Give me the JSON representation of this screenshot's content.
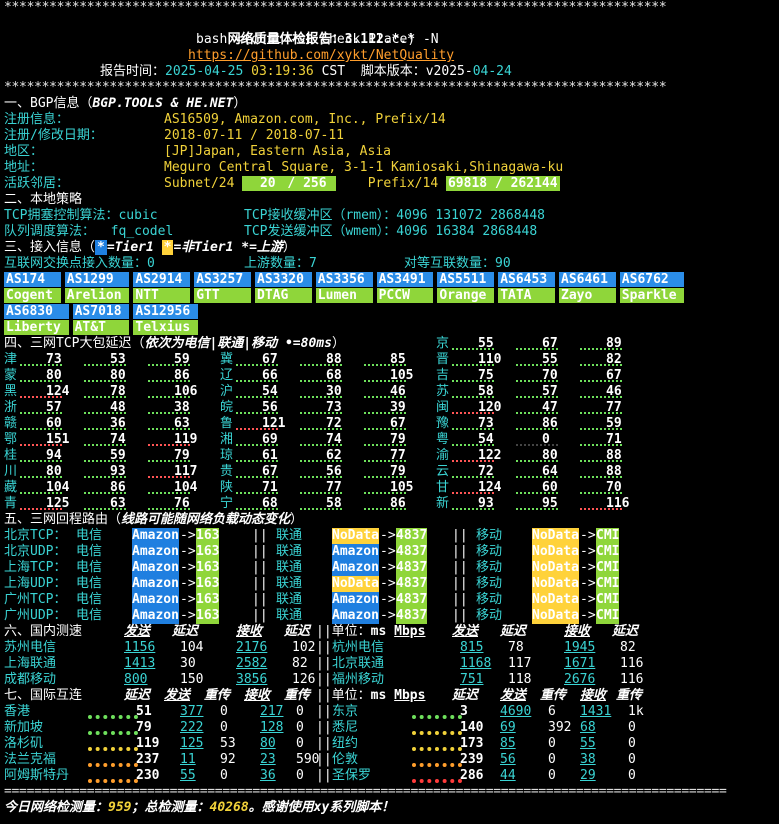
{
  "header": {
    "stars_line": "****************************************************************************************",
    "title": "网络质量体检报告：3.112.*.*",
    "command": "bash <(curl -sL Check.Place) -N",
    "url": "https://github.com/xykt/NetQuality",
    "report_time_label": "报告时间：",
    "report_date": "2025-04-25",
    "report_clock": "03:19:36",
    "report_tz": "CST",
    "script_version_label": "脚本版本：",
    "script_version_prefix": "v2025-",
    "script_version_date": "04-24"
  },
  "bgp": {
    "section_title": "一、BGP信息（",
    "section_source": "BGP.TOOLS & HE.NET",
    "section_close": "）",
    "reg_info_label": "注册信息：",
    "reg_info_value": "AS16509, Amazon.com, Inc., Prefix/14",
    "reg_date_label": "注册/修改日期：",
    "reg_date_value": "2018-07-11 / 2018-07-11",
    "region_label": "地区：",
    "region_value": "[JP]Japan, Eastern Asia, Asia",
    "address_label": "地址：",
    "address_value": "Meguro Central Square, 3-1-1 Kamiosaki,Shinagawa-ku",
    "neighbors_label": "活跃邻居：",
    "subnet_label": "Subnet/24",
    "subnet_a": "20",
    "subnet_b": "256",
    "prefix_label": "Prefix/14",
    "prefix_a": "69818",
    "prefix_b": "262144"
  },
  "local": {
    "section_title": "二、本地策略",
    "congestion_label": "TCP拥塞控制算法：",
    "congestion_value": "cubic",
    "rmem_label": "TCP接收缓冲区（rmem）：",
    "rmem_value": "4096 131072 2868448",
    "qdisc_label": "队列调度算法：",
    "qdisc_value": "fq_codel",
    "wmem_label": "TCP发送缓冲区（wmem）：",
    "wmem_value": "4096 16384 2868448"
  },
  "access": {
    "section_title": "三、接入信息（",
    "legend_tier1": "=Tier1",
    "legend_nontier1": "=非Tier1",
    "legend_upstream": "=上游",
    "legend_close": "）",
    "ix_label": "互联网交换点接入数量：",
    "ix_value": "0",
    "upstream_label": "上游数量：",
    "upstream_value": "7",
    "peer_label": "对等互联数量：",
    "peer_value": "90",
    "row1": [
      {
        "as": "AS174",
        "name": "Cogent"
      },
      {
        "as": "AS1299",
        "name": "Arelion"
      },
      {
        "as": "AS2914",
        "name": "NTT"
      },
      {
        "as": "AS3257",
        "name": "GTT"
      },
      {
        "as": "AS3320",
        "name": "DTAG"
      },
      {
        "as": "AS3356",
        "name": "Lumen"
      },
      {
        "as": "AS3491",
        "name": "PCCW"
      },
      {
        "as": "AS5511",
        "name": "Orange"
      },
      {
        "as": "AS6453",
        "name": "TATA"
      },
      {
        "as": "AS6461",
        "name": "Zayo"
      },
      {
        "as": "AS6762",
        "name": "Sparkle"
      }
    ],
    "row2": [
      {
        "as": "AS6830",
        "name": "Liberty"
      },
      {
        "as": "AS7018",
        "name": "AT&T"
      },
      {
        "as": "AS12956",
        "name": "Telxius"
      }
    ]
  },
  "latency": {
    "section_title": "四、三网TCP大包延迟（",
    "section_note": "依次为电信|联通|移动 •=80ms",
    "section_close": "）",
    "rows": [
      [
        [
          "京",
          "55",
          "67",
          "89"
        ]
      ],
      [
        [
          "津",
          "73",
          "53",
          "59"
        ],
        [
          "冀",
          "67",
          "88",
          "85"
        ],
        [
          "晋",
          "110",
          "55",
          "82"
        ]
      ],
      [
        [
          "蒙",
          "80",
          "80",
          "86"
        ],
        [
          "辽",
          "66",
          "68",
          "105"
        ],
        [
          "吉",
          "75",
          "70",
          "67"
        ]
      ],
      [
        [
          "黑",
          "124",
          "78",
          "106"
        ],
        [
          "沪",
          "54",
          "30",
          "46"
        ],
        [
          "苏",
          "58",
          "57",
          "46"
        ]
      ],
      [
        [
          "浙",
          "57",
          "48",
          "38"
        ],
        [
          "皖",
          "56",
          "73",
          "39"
        ],
        [
          "闽",
          "120",
          "47",
          "77"
        ]
      ],
      [
        [
          "赣",
          "60",
          "36",
          "63"
        ],
        [
          "鲁",
          "121",
          "72",
          "67"
        ],
        [
          "豫",
          "73",
          "86",
          "59"
        ]
      ],
      [
        [
          "鄂",
          "151",
          "74",
          "119"
        ],
        [
          "湘",
          "69",
          "74",
          "79"
        ],
        [
          "粤",
          "54",
          "0",
          "71"
        ]
      ],
      [
        [
          "桂",
          "94",
          "59",
          "79"
        ],
        [
          "琼",
          "61",
          "62",
          "77"
        ],
        [
          "渝",
          "122",
          "80",
          "88"
        ]
      ],
      [
        [
          "川",
          "80",
          "93",
          "117"
        ],
        [
          "贵",
          "67",
          "56",
          "79"
        ],
        [
          "云",
          "72",
          "64",
          "88"
        ]
      ],
      [
        [
          "藏",
          "104",
          "86",
          "104"
        ],
        [
          "陕",
          "71",
          "77",
          "105"
        ],
        [
          "甘",
          "124",
          "60",
          "70"
        ]
      ],
      [
        [
          "青",
          "125",
          "63",
          "76"
        ],
        [
          "宁",
          "68",
          "58",
          "86"
        ],
        [
          "新",
          "93",
          "95",
          "116"
        ]
      ]
    ]
  },
  "routes": {
    "section_title": "五、三网回程路由（",
    "section_note": "线路可能随网络负载动态变化",
    "section_close": "）",
    "rows": [
      {
        "label": "北京TCP：",
        "isp1": "电信",
        "r1a": "Amazon",
        "r1b": "163",
        "isp2": "联通",
        "r2a": "NoData",
        "r2b": "4837",
        "isp3": "移动",
        "r3a": "NoData",
        "r3b": "CMI"
      },
      {
        "label": "北京UDP：",
        "isp1": "电信",
        "r1a": "Amazon",
        "r1b": "163",
        "isp2": "联通",
        "r2a": "Amazon",
        "r2b": "4837",
        "isp3": "移动",
        "r3a": "NoData",
        "r3b": "CMI"
      },
      {
        "label": "上海TCP：",
        "isp1": "电信",
        "r1a": "Amazon",
        "r1b": "163",
        "isp2": "联通",
        "r2a": "Amazon",
        "r2b": "4837",
        "isp3": "移动",
        "r3a": "NoData",
        "r3b": "CMI"
      },
      {
        "label": "上海UDP：",
        "isp1": "电信",
        "r1a": "Amazon",
        "r1b": "163",
        "isp2": "联通",
        "r2a": "NoData",
        "r2b": "4837",
        "isp3": "移动",
        "r3a": "NoData",
        "r3b": "CMI"
      },
      {
        "label": "广州TCP：",
        "isp1": "电信",
        "r1a": "Amazon",
        "r1b": "163",
        "isp2": "联通",
        "r2a": "Amazon",
        "r2b": "4837",
        "isp3": "移动",
        "r3a": "NoData",
        "r3b": "CMI"
      },
      {
        "label": "广州UDP：",
        "isp1": "电信",
        "r1a": "Amazon",
        "r1b": "163",
        "isp2": "联通",
        "r2a": "Amazon",
        "r2b": "4837",
        "isp3": "移动",
        "r3a": "NoData",
        "r3b": "CMI"
      }
    ]
  },
  "domestic": {
    "section_title": "六、国内测速",
    "col_send": "发送",
    "col_lat": "延迟",
    "col_recv": "接收",
    "col_lat2": "延迟",
    "unit_label": "单位：",
    "unit_ms": "ms",
    "unit_mbps": "Mbps",
    "rows": [
      {
        "l": "苏州电信",
        "ls": "1156",
        "ll": "104",
        "lr": "2176",
        "ll2": "102",
        "r": "杭州电信",
        "rs": "815",
        "rl": "78",
        "rr": "1945",
        "rl2": "82"
      },
      {
        "l": "上海联通",
        "ls": "1413",
        "ll": "30",
        "lr": "2582",
        "ll2": "82",
        "r": "北京联通",
        "rs": "1168",
        "rl": "117",
        "rr": "1671",
        "rl2": "116"
      },
      {
        "l": "成都移动",
        "ls": "800",
        "ll": "150",
        "lr": "3856",
        "ll2": "126",
        "r": "福州移动",
        "rs": "751",
        "rl": "118",
        "rr": "2676",
        "rl2": "116"
      }
    ]
  },
  "intl": {
    "section_title": "七、国际互连",
    "col_lat": "延迟",
    "col_send": "发送",
    "col_retx": "重传",
    "col_recv": "接收",
    "col_retx2": "重传",
    "unit_label": "单位：",
    "unit_ms": "ms",
    "unit_mbps": "Mbps",
    "rows": [
      {
        "l": "香港",
        "ll": "51",
        "ls": "377",
        "lrt": "0",
        "lr": "217",
        "lrt2": "0",
        "r": "东京",
        "rl": "3",
        "rs": "4690",
        "rrt": "6",
        "rr": "1431",
        "rrt2": "1k"
      },
      {
        "l": "新加坡",
        "ll": "79",
        "ls": "222",
        "lrt": "0",
        "lr": "128",
        "lrt2": "0",
        "r": "悉尼",
        "rl": "140",
        "rs": "69",
        "rrt": "392",
        "rr": "68",
        "rrt2": "0"
      },
      {
        "l": "洛杉矶",
        "ll": "119",
        "ls": "125",
        "lrt": "53",
        "lr": "80",
        "lrt2": "0",
        "r": "纽约",
        "rl": "173",
        "rs": "85",
        "rrt": "0",
        "rr": "55",
        "rrt2": "0"
      },
      {
        "l": "法兰克福",
        "ll": "237",
        "ls": "11",
        "lrt": "92",
        "lr": "23",
        "lrt2": "590",
        "r": "伦敦",
        "rl": "239",
        "rs": "56",
        "rrt": "0",
        "rr": "38",
        "rrt2": "0"
      },
      {
        "l": "阿姆斯特丹",
        "ll": "230",
        "ls": "55",
        "lrt": "0",
        "lr": "36",
        "lrt2": "0",
        "r": "圣保罗",
        "rl": "286",
        "rs": "44",
        "rrt": "0",
        "rr": "29",
        "rrt2": "0"
      }
    ]
  },
  "footer": {
    "prefix": "今日网络检测量：",
    "today": "959",
    "mid": "；总检测量：",
    "total": "40268",
    "suffix": "。感谢使用xy系列脚本！"
  }
}
